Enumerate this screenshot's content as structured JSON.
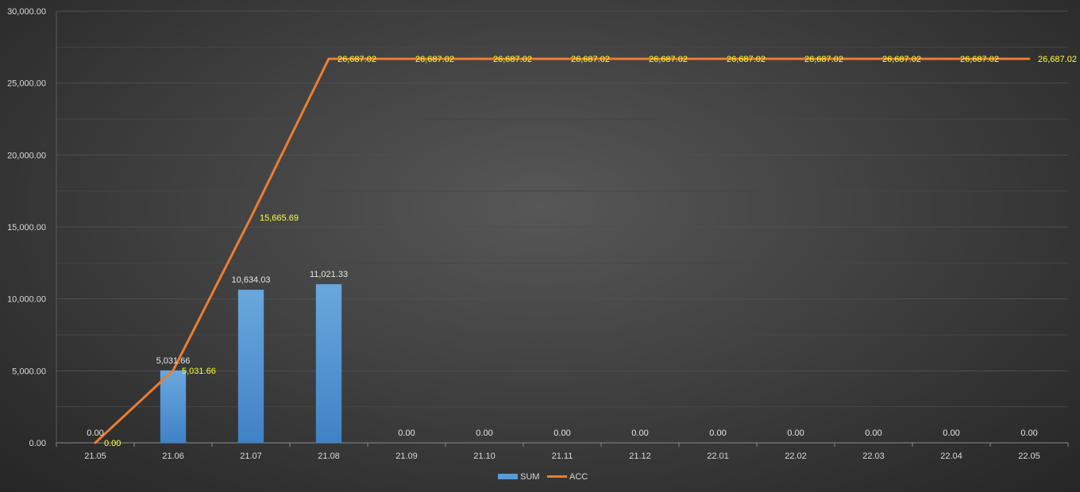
{
  "chart_data": {
    "type": "bar",
    "categories": [
      "21.05",
      "21.06",
      "21.07",
      "21.08",
      "21.09",
      "21.10",
      "21.11",
      "21.12",
      "22.01",
      "22.02",
      "22.03",
      "22.04",
      "22.05"
    ],
    "series": [
      {
        "name": "SUM",
        "type": "bar",
        "values": [
          0,
          5031.66,
          10634.03,
          11021.33,
          0,
          0,
          0,
          0,
          0,
          0,
          0,
          0,
          0
        ],
        "labels": [
          "0.00",
          "5,031.66",
          "10,634.03",
          "11,021.33",
          "0.00",
          "0.00",
          "0.00",
          "0.00",
          "0.00",
          "0.00",
          "0.00",
          "0.00",
          "0.00"
        ],
        "color": "#5b9bd5"
      },
      {
        "name": "ACC",
        "type": "line",
        "values": [
          0,
          5031.66,
          15665.69,
          26687.02,
          26687.02,
          26687.02,
          26687.02,
          26687.02,
          26687.02,
          26687.02,
          26687.02,
          26687.02,
          26687.02
        ],
        "labels": [
          "0.00",
          "5,031.66",
          "15,665.69",
          "26,687.02",
          "26,687.02",
          "26,687.02",
          "26,687.02",
          "26,687.02",
          "26,687.02",
          "26,687.02",
          "26,687.02",
          "26,687.02",
          "26,687.02"
        ],
        "color": "#ed7d31"
      }
    ],
    "yticks": [
      "0.00",
      "5,000.00",
      "10,000.00",
      "15,000.00",
      "20,000.00",
      "25,000.00",
      "30,000.00"
    ],
    "ylim": [
      0,
      30000
    ],
    "title": "",
    "xlabel": "",
    "ylabel": "",
    "grid": true,
    "legend": "bottom",
    "label_colors": {
      "bar_label": "#e6e6e6",
      "line_label": "#ffff33",
      "axis_text": "#d9d9d9",
      "gridline": "#4f4f4f"
    }
  }
}
